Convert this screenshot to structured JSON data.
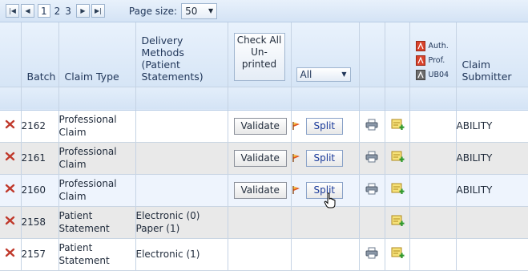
{
  "pager": {
    "pages": [
      "1",
      "2",
      "3"
    ],
    "current": "1",
    "page_size_label": "Page size:",
    "page_size_value": "50"
  },
  "columns": {
    "batch": "Batch",
    "claim_type": "Claim Type",
    "delivery": "Delivery Methods (Patient Statements)",
    "check_all": "Check All Un-printed",
    "filter_value": "All",
    "legend": [
      "Auth.",
      "Prof.",
      "UB04"
    ],
    "claim_submitter": "Claim Submitter"
  },
  "actions": {
    "validate": "Validate",
    "split": "Split"
  },
  "rows": [
    {
      "batch": "2162",
      "type_line1": "Professional",
      "type_line2": "Claim",
      "delivery_line1": "",
      "delivery_line2": "",
      "validate": true,
      "split": true,
      "print": true,
      "submitter": "ABILITY"
    },
    {
      "batch": "2161",
      "type_line1": "Professional",
      "type_line2": "Claim",
      "delivery_line1": "",
      "delivery_line2": "",
      "validate": true,
      "split": true,
      "print": true,
      "submitter": "ABILITY"
    },
    {
      "batch": "2160",
      "type_line1": "Professional",
      "type_line2": "Claim",
      "delivery_line1": "",
      "delivery_line2": "",
      "validate": true,
      "split": true,
      "print": true,
      "submitter": "ABILITY"
    },
    {
      "batch": "2158",
      "type_line1": "Patient",
      "type_line2": "Statement",
      "delivery_line1": "Electronic (0)",
      "delivery_line2": "Paper (1)",
      "validate": false,
      "split": false,
      "print": false,
      "submitter": ""
    },
    {
      "batch": "2157",
      "type_line1": "Patient",
      "type_line2": "Statement",
      "delivery_line1": "Electronic (1)",
      "delivery_line2": "",
      "validate": false,
      "split": false,
      "print": true,
      "submitter": ""
    }
  ],
  "colors": {
    "header_bg": "#d6e5f6",
    "alt_row": "#e9e9e9",
    "hover_row": "#eef4fd",
    "delete_red": "#c0392b",
    "split_text": "#1a3a9a"
  },
  "icons": {
    "delete": "delete-x-icon",
    "flag": "flag-icon",
    "print": "printer-icon",
    "add_note": "add-note-icon",
    "pdf": "pdf-icon",
    "pointer": "hand-pointer-icon"
  }
}
